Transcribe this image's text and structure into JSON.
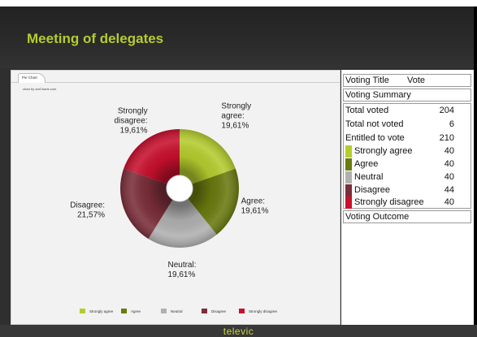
{
  "app": {
    "title": "Meeting of delegates",
    "footer_logo": "televic"
  },
  "tabs": [
    {
      "label": "Pie Chart"
    }
  ],
  "chart_credit": "chart by amCharts.com",
  "chart_data": {
    "type": "pie",
    "donut": true,
    "categories": [
      "Strongly agree",
      "Agree",
      "Neutral",
      "Disagree",
      "Strongly disagree"
    ],
    "values": [
      40,
      40,
      40,
      44,
      40
    ],
    "colors": [
      "#b5cc2e",
      "#6a7a10",
      "#b0b0b0",
      "#7a2e3a",
      "#c8102e"
    ],
    "slice_labels": [
      [
        "Strongly",
        "agree:",
        "19,61%"
      ],
      [
        "Agree:",
        "19,61%"
      ],
      [
        "Neutral:",
        "19,61%"
      ],
      [
        "Disagree:",
        "21,57%"
      ],
      [
        "Strongly",
        "disagree:",
        "19,61%"
      ]
    ],
    "legend_position": "bottom"
  },
  "panel": {
    "voting_title_label": "Voting Title",
    "voting_title_value": "Vote",
    "summary_label": "Voting Summary",
    "stats": [
      {
        "label": "Total voted",
        "value": "204"
      },
      {
        "label": "Total not voted",
        "value": "6"
      },
      {
        "label": "Entitled to vote",
        "value": "210"
      }
    ],
    "votes": [
      {
        "label": "Strongly agree",
        "value": "40",
        "color": "#b5cc2e"
      },
      {
        "label": "Agree",
        "value": "40",
        "color": "#6a7a10"
      },
      {
        "label": "Neutral",
        "value": "40",
        "color": "#b0b0b0"
      },
      {
        "label": "Disagree",
        "value": "44",
        "color": "#7a2e3a"
      },
      {
        "label": "Strongly disagree",
        "value": "40",
        "color": "#c8102e"
      }
    ],
    "outcome_label": "Voting Outcome"
  }
}
